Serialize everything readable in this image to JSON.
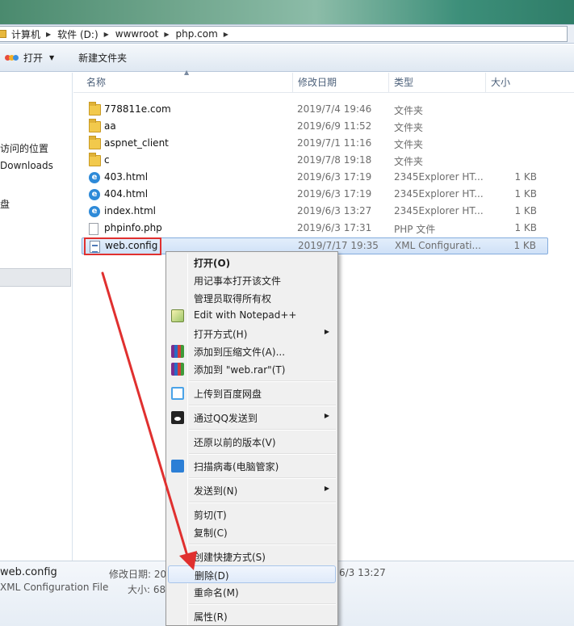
{
  "breadcrumb": [
    "计算机",
    "软件 (D:)",
    "wwwroot",
    "php.com"
  ],
  "toolbar": {
    "open_label": "打开",
    "new_folder_label": "新建文件夹"
  },
  "nav": {
    "item1": "访问的位置",
    "item2": "Downloads",
    "item3": "盘"
  },
  "columns": {
    "name": "名称",
    "date": "修改日期",
    "type": "类型",
    "size": "大小"
  },
  "files": [
    {
      "name": "778811e.com",
      "date": "2019/7/4 19:46",
      "type": "文件夹",
      "size": "",
      "icon": "folder-icon"
    },
    {
      "name": "aa",
      "date": "2019/6/9 11:52",
      "type": "文件夹",
      "size": "",
      "icon": "folder-icon"
    },
    {
      "name": "aspnet_client",
      "date": "2019/7/1 11:16",
      "type": "文件夹",
      "size": "",
      "icon": "folder-icon"
    },
    {
      "name": "c",
      "date": "2019/7/8 19:18",
      "type": "文件夹",
      "size": "",
      "icon": "folder-icon"
    },
    {
      "name": "403.html",
      "date": "2019/6/3 17:19",
      "type": "2345Explorer HT...",
      "size": "1 KB",
      "icon": "html-file-icon"
    },
    {
      "name": "404.html",
      "date": "2019/6/3 17:19",
      "type": "2345Explorer HT...",
      "size": "1 KB",
      "icon": "html-file-icon"
    },
    {
      "name": "index.html",
      "date": "2019/6/3 13:27",
      "type": "2345Explorer HT...",
      "size": "1 KB",
      "icon": "html-file-icon"
    },
    {
      "name": "phpinfo.php",
      "date": "2019/6/3 17:31",
      "type": "PHP 文件",
      "size": "1 KB",
      "icon": "php-file-icon"
    },
    {
      "name": "web.config",
      "date": "2019/7/17 19:35",
      "type": "XML Configurati...",
      "size": "1 KB",
      "icon": "config-file-icon"
    }
  ],
  "status": {
    "filename": "web.config",
    "filetype": "XML Configuration File",
    "date_label": "修改日期: 20",
    "size_label": "大小: 68",
    "date_tail": "6/3 13:27"
  },
  "context_menu": {
    "open": "打开(O)",
    "open_notepad": "用记事本打开该文件",
    "take_ownership": "管理员取得所有权",
    "edit_notepadpp": "Edit with Notepad++",
    "open_with": "打开方式(H)",
    "add_archive": "添加到压缩文件(A)...",
    "add_web_rar": "添加到 \"web.rar\"(T)",
    "baidu_upload": "上传到百度网盘",
    "qq_send": "通过QQ发送到",
    "restore_versions": "还原以前的版本(V)",
    "scan_virus": "扫描病毒(电脑管家)",
    "send_to": "发送到(N)",
    "cut": "剪切(T)",
    "copy": "复制(C)",
    "create_shortcut": "创建快捷方式(S)",
    "delete": "删除(D)",
    "rename": "重命名(M)",
    "properties": "属性(R)"
  },
  "accent_color": "#e0302f"
}
